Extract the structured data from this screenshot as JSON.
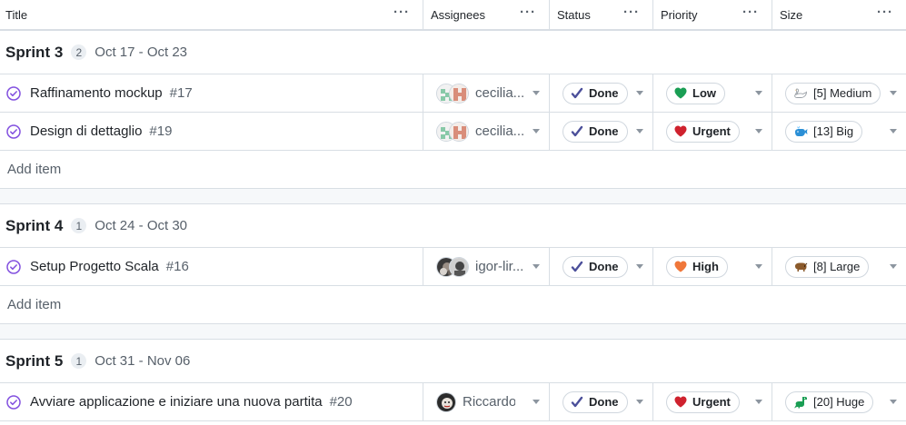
{
  "columns": {
    "title": "Title",
    "assignees": "Assignees",
    "status": "Status",
    "priority": "Priority",
    "size": "Size"
  },
  "add_item_label": "Add item",
  "groups": [
    {
      "name": "Sprint 3",
      "count": "2",
      "dates": "Oct 17 - Oct 23",
      "rows": [
        {
          "title": "Raffinamento mockup",
          "number": "#17",
          "assignee": "cecilia...",
          "status": "Done",
          "priority": "Low",
          "priority_icon": "green-heart-icon",
          "size": "[5] Medium",
          "size_icon": "swan-icon"
        },
        {
          "title": "Design di dettaglio",
          "number": "#19",
          "assignee": "cecilia...",
          "status": "Done",
          "priority": "Urgent",
          "priority_icon": "red-heart-icon",
          "size": "[13] Big",
          "size_icon": "whale-icon"
        }
      ]
    },
    {
      "name": "Sprint 4",
      "count": "1",
      "dates": "Oct 24 - Oct 30",
      "rows": [
        {
          "title": "Setup Progetto Scala",
          "number": "#16",
          "assignee": "igor-lir...",
          "status": "Done",
          "priority": "High",
          "priority_icon": "orange-heart-icon",
          "size": "[8] Large",
          "size_icon": "bison-icon"
        }
      ]
    },
    {
      "name": "Sprint 5",
      "count": "1",
      "dates": "Oct 31 - Nov 06",
      "rows": [
        {
          "title": "Avviare applicazione e iniziare una nuova partita",
          "number": "#20",
          "assignee": "RiccardoC",
          "status": "Done",
          "priority": "Urgent",
          "priority_icon": "red-heart-icon",
          "size": "[20] Huge",
          "size_icon": "dinosaur-icon"
        }
      ]
    }
  ],
  "colors": {
    "done_icon": "#8250df",
    "check": "#4b4f9a",
    "heart_green": "#1a9e54",
    "heart_red": "#cf222e",
    "heart_orange": "#f0773a"
  }
}
